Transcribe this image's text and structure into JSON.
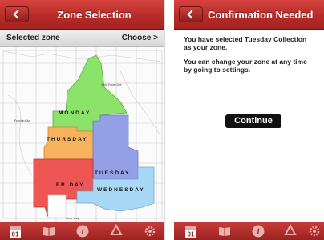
{
  "left_screen": {
    "title": "Zone Selection",
    "selected_zone_label": "Selected zone",
    "choose_label": "Choose >",
    "map": {
      "zones": [
        "MONDAY",
        "THURSDAY",
        "TUESDAY",
        "FRIDAY",
        "WEDNESDAY"
      ],
      "zone_colors": {
        "monday": "#8be36a",
        "thursday": "#f7b25e",
        "tuesday": "#93a0e6",
        "friday": "#ee5555",
        "wednesday": "#a8d8f6"
      },
      "street_labels": [
        "Sixty-Fourth Ave",
        "Franklin Blvd",
        "Arbor Way"
      ]
    },
    "tabs": [
      "calendar-icon",
      "book-icon",
      "info-icon",
      "recycle-icon",
      "gear-icon"
    ]
  },
  "right_screen": {
    "title": "Confirmation Needed",
    "message_line1": "You have selected Tuesday Collection",
    "message_line2": "as your zone.",
    "message_line3": "You can change your zone at any time",
    "message_line4": "by going to settings.",
    "continue_label": "Continue",
    "tabs": [
      "calendar-icon",
      "book-icon",
      "info-icon",
      "recycle-icon",
      "gear-icon"
    ]
  },
  "colors": {
    "nav_red": "#b42a27",
    "tab_red": "#b03230"
  }
}
